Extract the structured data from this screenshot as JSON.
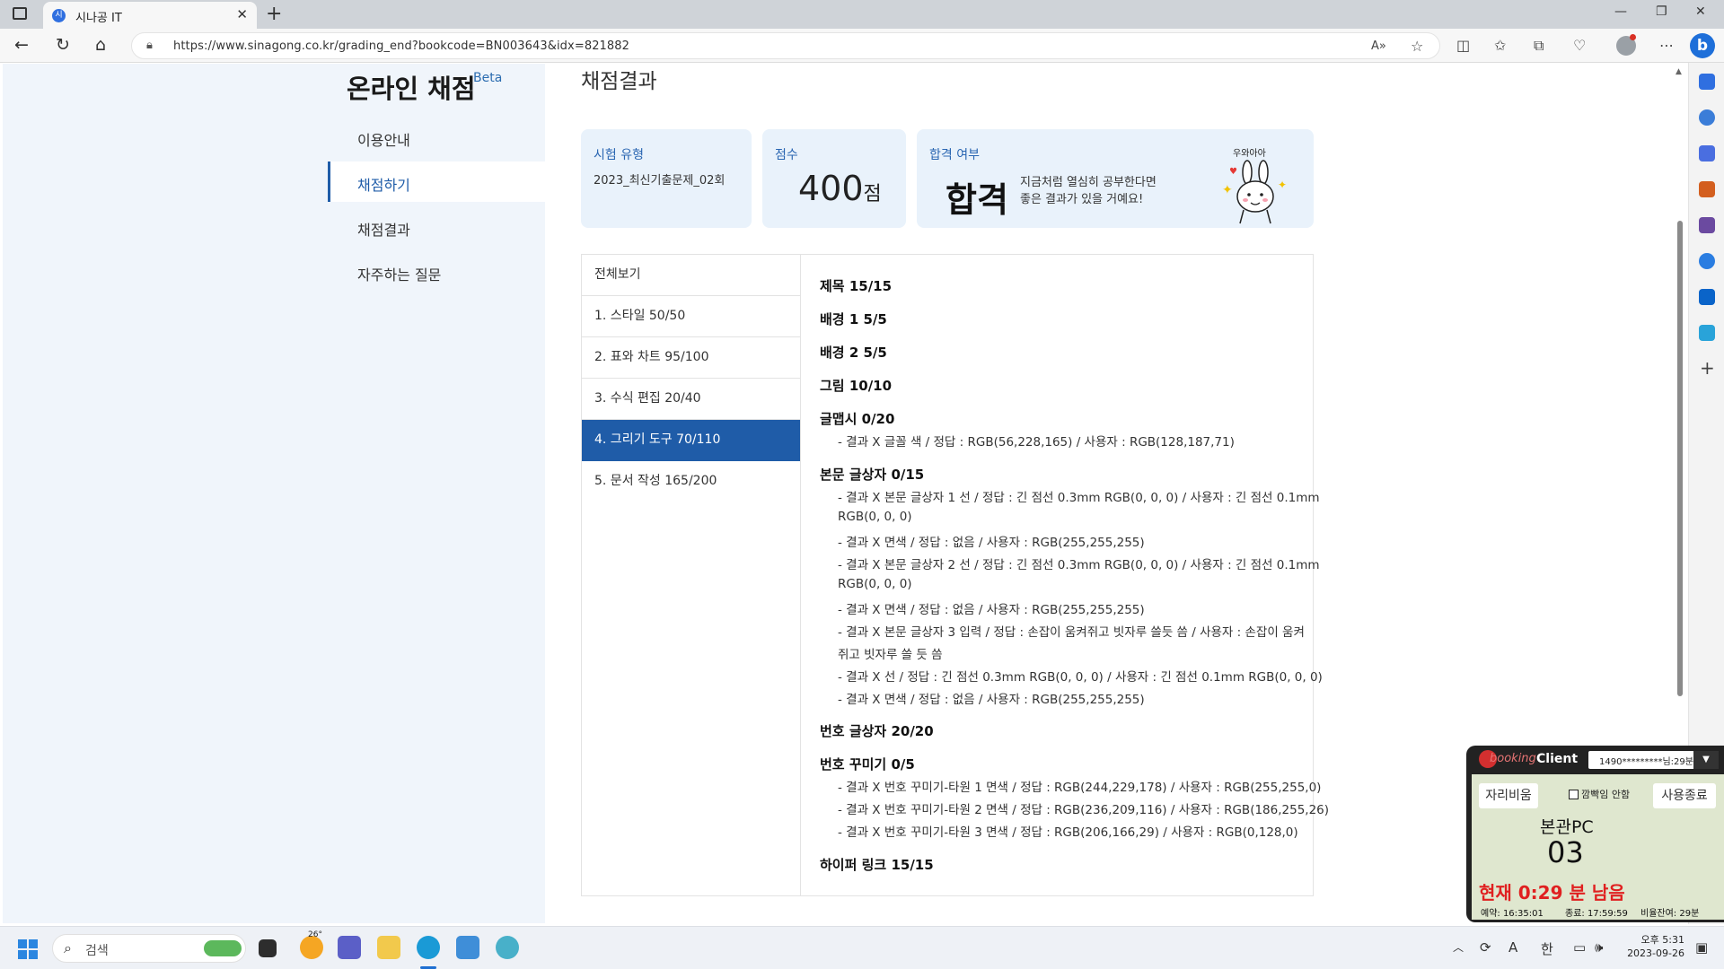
{
  "browser": {
    "tab_title": "시나공 IT",
    "tab_favicon": "시",
    "url_host": "https://www.sinagong.co.kr",
    "url_path": "/grading_end?bookcode=BN003643&idx=821882"
  },
  "sidebar": {
    "title": "온라인 채점",
    "beta": "Beta",
    "items": [
      {
        "label": "이용안내"
      },
      {
        "label": "채점하기"
      },
      {
        "label": "채점결과"
      },
      {
        "label": "자주하는 질문"
      }
    ]
  },
  "main": {
    "title": "채점결과",
    "exam_type_label": "시험 유형",
    "exam_type_value": "2023_최신기출문제_02회",
    "score_label": "점수",
    "score_value": "400",
    "score_unit": "점",
    "pass_label": "합격 여부",
    "pass_value": "합격",
    "pass_message_1": "지금처럼 열심히 공부한다면",
    "pass_message_2": "좋은 결과가 있을 거예요!",
    "mascot_text": "우와아아"
  },
  "categories": [
    {
      "label": "전체보기"
    },
    {
      "label": "1. 스타일 50/50"
    },
    {
      "label": "2. 표와 차트 95/100"
    },
    {
      "label": "3. 수식 편집 20/40"
    },
    {
      "label": "4. 그리기 도구 70/110"
    },
    {
      "label": "5. 문서 작성 165/200"
    }
  ],
  "details": [
    {
      "title": "제목 15/15",
      "lines": []
    },
    {
      "title": "배경 1 5/5",
      "lines": []
    },
    {
      "title": "배경 2 5/5",
      "lines": []
    },
    {
      "title": "그림 10/10",
      "lines": []
    },
    {
      "title": "글맵시 0/20",
      "lines": [
        "- 결과 X 글꼴 색 / 정답 : RGB(56,228,165) / 사용자 : RGB(128,187,71)"
      ]
    },
    {
      "title": "본문 글상자 0/15",
      "lines": [
        "- 결과 X 본문 글상자 1 선 / 정답 : 긴 점선 0.3mm RGB(0, 0, 0) / 사용자 : 긴 점선 0.1mm",
        "RGB(0, 0, 0)",
        "- 결과 X 면색 / 정답 : 없음 / 사용자 : RGB(255,255,255)",
        "- 결과 X 본문 글상자 2 선 / 정답 : 긴 점선 0.3mm RGB(0, 0, 0) / 사용자 : 긴 점선 0.1mm",
        "RGB(0, 0, 0)",
        "- 결과 X 면색 / 정답 : 없음 / 사용자 : RGB(255,255,255)",
        "- 결과 X 본문 글상자 3 입력 / 정답 : 손잡이 움켜쥐고 빗자루 쓸듯 씀 / 사용자 : 손잡이 움켜",
        "쥐고 빗자루 쓸 듯 씀",
        "- 결과 X 선 / 정답 : 긴 점선 0.3mm RGB(0, 0, 0) / 사용자 : 긴 점선 0.1mm RGB(0, 0, 0)",
        "- 결과 X 면색 / 정답 : 없음 / 사용자 : RGB(255,255,255)"
      ]
    },
    {
      "title": "번호 글상자 20/20",
      "lines": []
    },
    {
      "title": "번호 꾸미기 0/5",
      "lines": [
        "- 결과 X 번호 꾸미기-타원 1 면색 / 정답 : RGB(244,229,178) / 사용자 : RGB(255,255,0)",
        "- 결과 X 번호 꾸미기-타원 2 면색 / 정답 : RGB(236,209,116) / 사용자 : RGB(186,255,26)",
        "- 결과 X 번호 꾸미기-타원 3 면색 / 정답 : RGB(206,166,29) / 사용자 : RGB(0,128,0)"
      ]
    },
    {
      "title": "하이퍼 링크 15/15",
      "lines": []
    }
  ],
  "booking": {
    "brand": "booking",
    "client": "Client",
    "dropdown": "1490*********님:29분",
    "seat_move": "자리비움",
    "hide_label": "깜빡임 안함",
    "end_use": "사용종료",
    "pc_name": "본관PC",
    "pc_number": "03",
    "remaining": "현재 0:29 분 남음",
    "reserve": "예약: 16:35:01",
    "end": "종료: 17:59:59",
    "prepaid": "비율잔여: 29분"
  },
  "taskbar": {
    "search_label": "검색",
    "weather_temp": "26°",
    "ime": "한",
    "ime_a": "A",
    "time": "오후 5:31",
    "date": "2023-09-26"
  },
  "colors": {
    "accent": "#1f5ca8",
    "card_bg": "#e9f2fb",
    "sidebar_bg": "#f0f5fb",
    "remain_red": "#e02020"
  }
}
